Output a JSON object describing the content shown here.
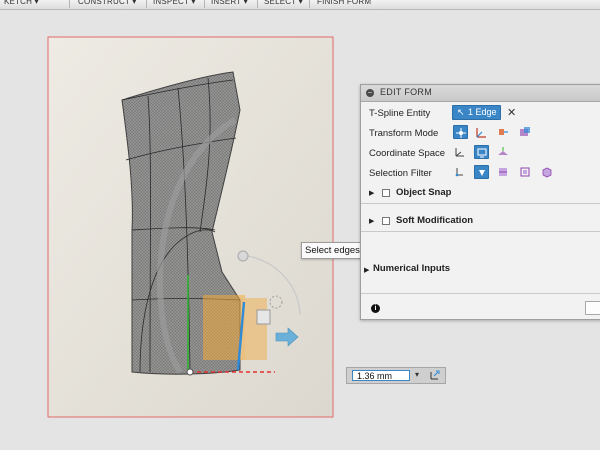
{
  "toolbar": {
    "items": [
      "KETCH ▾",
      "CONSTRUCT ▾",
      "INSPECT ▾",
      "INSERT ▾",
      "SELECT ▾",
      "FINISH FORM"
    ]
  },
  "panel": {
    "title": "EDIT FORM",
    "collapse_glyph": "–",
    "tspline_label": "T-Spline Entity",
    "entity_value": "1 Edge",
    "clear_glyph": "✕",
    "transform_label": "Transform Mode",
    "coord_label": "Coordinate Space",
    "filter_label": "Selection Filter",
    "object_snap_label": "Object Snap",
    "soft_mod_label": "Soft Modification",
    "numerical_label": "Numerical Inputs",
    "info_glyph": "i"
  },
  "tooltip": {
    "text": "Select edges. Alt Key to extrude"
  },
  "distance": {
    "value": "1.36 mm"
  },
  "colors": {
    "accent": "#3b86c7",
    "panel_bg": "#f2f2f2",
    "canvas_border": "#e06a6a",
    "manipulator_orange": "#f2a93b",
    "manipulator_blue": "#6ab0d8"
  },
  "icons": [
    "pointer-icon",
    "close-icon",
    "all-transform-icon",
    "move-icon",
    "rotate-icon",
    "scale-icon",
    "world-space-icon",
    "view-space-icon",
    "local-space-icon",
    "vertex-filter-icon",
    "edge-filter-icon",
    "face-filter-icon",
    "body-filter-icon",
    "object-filter-icon",
    "info-icon",
    "snap-point-icon"
  ]
}
